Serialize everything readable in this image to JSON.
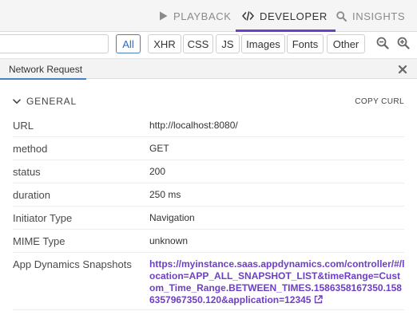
{
  "tabs": [
    {
      "label": "PLAYBACK",
      "icon": "play-icon"
    },
    {
      "label": "DEVELOPER",
      "icon": "code-icon"
    },
    {
      "label": "INSIGHTS",
      "icon": "search-icon"
    }
  ],
  "filters": {
    "search_value": "",
    "buttons": [
      "All",
      "XHR",
      "CSS",
      "JS",
      "Images",
      "Fonts",
      "Other"
    ],
    "active": "All"
  },
  "panel": {
    "tab_label": "Network Request"
  },
  "general": {
    "title": "GENERAL",
    "copy_curl": "COPY CURL",
    "rows": [
      {
        "key": "URL",
        "value": "http://localhost:8080/"
      },
      {
        "key": "method",
        "value": "GET"
      },
      {
        "key": "status",
        "value": "200"
      },
      {
        "key": "duration",
        "value": "250 ms"
      },
      {
        "key": "Initiator Type",
        "value": "Navigation"
      },
      {
        "key": "MIME Type",
        "value": "unknown"
      },
      {
        "key": "App Dynamics Snapshots",
        "value": "https://myinstance.saas.appdynamics.com/controller/#/location=APP_ALL_SNAPSHOT_LIST&timeRange=Custom_Time_Range.BETWEEN_TIMES.1586358167350.1586357967350.120&application=12345"
      }
    ]
  },
  "colors": {
    "accent": "#6d3fc4",
    "active_filter": "#2d6ab8",
    "panel_tab_underline": "#4a7fc1"
  }
}
